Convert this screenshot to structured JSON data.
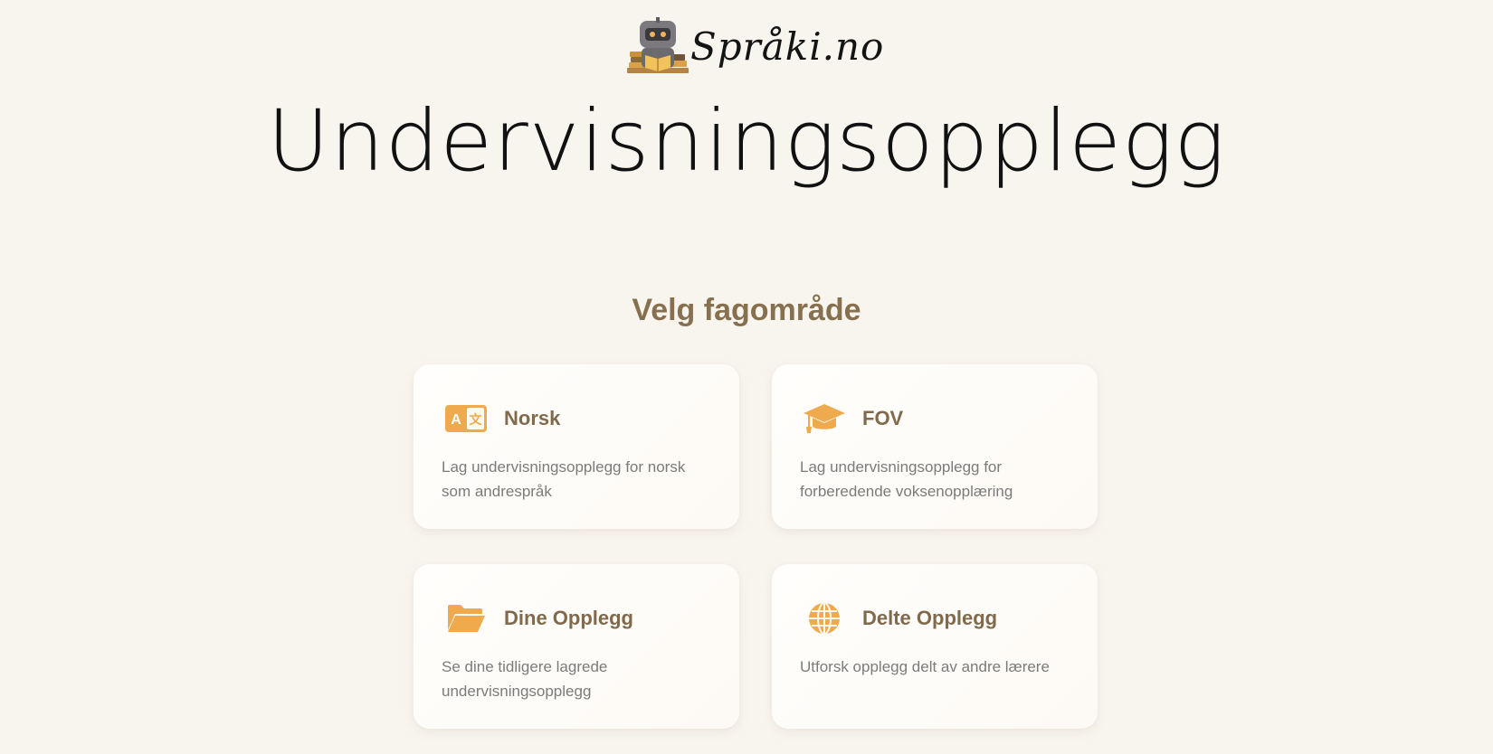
{
  "header": {
    "logo_text": "Språki.no",
    "title": "Undervisningsopplegg"
  },
  "section": {
    "title": "Velg fagområde"
  },
  "cards": [
    {
      "title": "Norsk",
      "description": "Lag undervisningsopplegg for norsk som andrespråk",
      "icon": "language-translate-icon",
      "icon_text": "A文"
    },
    {
      "title": "FOV",
      "description": "Lag undervisningsopplegg for forberedende voksenopplæring",
      "icon": "graduation-cap-icon"
    },
    {
      "title": "Dine Opplegg",
      "description": "Se dine tidligere lagrede undervisningsopplegg",
      "icon": "folder-open-icon"
    },
    {
      "title": "Delte Opplegg",
      "description": "Utforsk opplegg delt av andre lærere",
      "icon": "globe-icon"
    }
  ],
  "colors": {
    "background": "#f8f5ef",
    "accent_icon": "#eeaa4c",
    "heading_brown": "#86704f",
    "card_text": "#7b7b7b"
  }
}
